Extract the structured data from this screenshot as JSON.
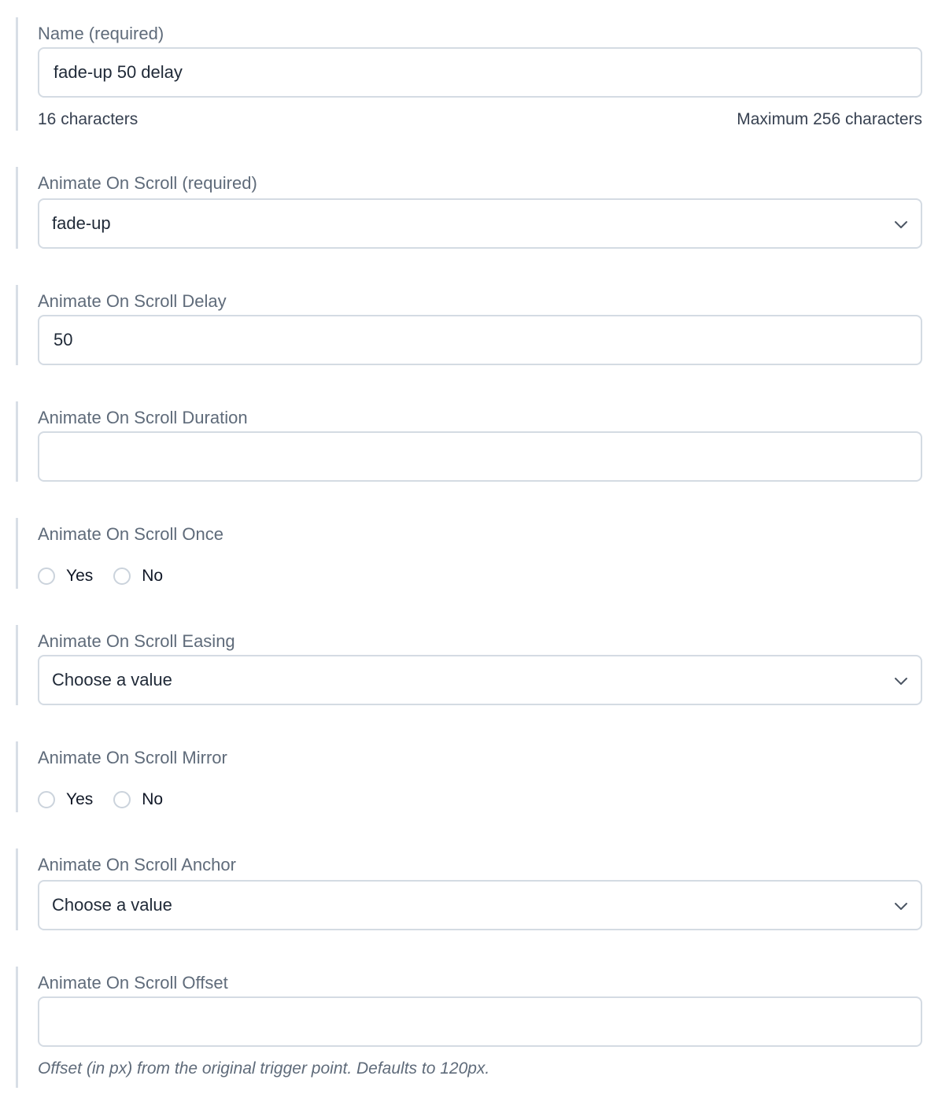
{
  "fields": {
    "name": {
      "label": "Name (required)",
      "value": "fade-up 50 delay",
      "count": "16 characters",
      "max": "Maximum 256 characters"
    },
    "aos": {
      "label": "Animate On Scroll (required)",
      "selected": "fade-up"
    },
    "delay": {
      "label": "Animate On Scroll Delay",
      "value": "50"
    },
    "duration": {
      "label": "Animate On Scroll Duration",
      "value": ""
    },
    "once": {
      "label": "Animate On Scroll Once",
      "yes": "Yes",
      "no": "No"
    },
    "easing": {
      "label": "Animate On Scroll Easing",
      "selected": "Choose a value"
    },
    "mirror": {
      "label": "Animate On Scroll Mirror",
      "yes": "Yes",
      "no": "No"
    },
    "anchor": {
      "label": "Animate On Scroll Anchor",
      "selected": "Choose a value"
    },
    "offset": {
      "label": "Animate On Scroll Offset",
      "value": "",
      "help": "Offset (in px) from the original trigger point. Defaults to 120px."
    }
  },
  "icons": {
    "select_arrow": "chevron-down-icon"
  }
}
